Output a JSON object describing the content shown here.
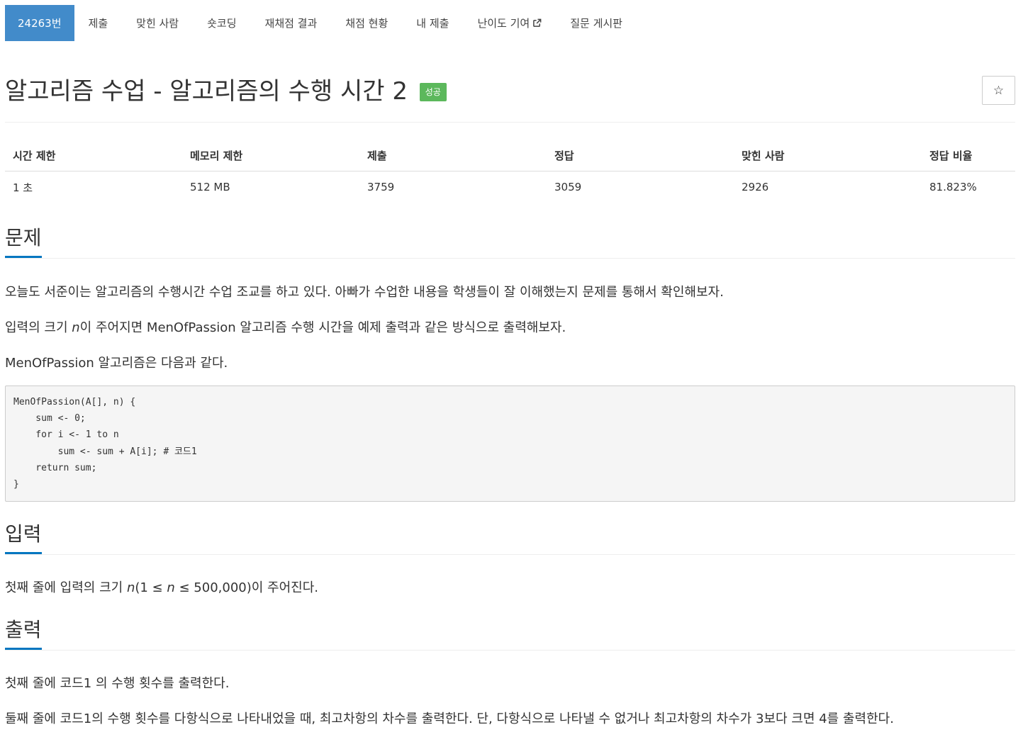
{
  "nav": {
    "items": [
      {
        "label": "24263번"
      },
      {
        "label": "제출"
      },
      {
        "label": "맞힌 사람"
      },
      {
        "label": "숏코딩"
      },
      {
        "label": "재채점 결과"
      },
      {
        "label": "채점 현황"
      },
      {
        "label": "내 제출"
      },
      {
        "label": "난이도 기여",
        "icon": "external-link-icon"
      },
      {
        "label": "질문 게시판"
      }
    ]
  },
  "problem": {
    "title": "알고리즘 수업 - 알고리즘의 수행 시간 2",
    "status_badge": "성공",
    "status_color": "#5cb85c",
    "star_icon": "☆"
  },
  "info_table": {
    "headers": [
      "시간 제한",
      "메모리 제한",
      "제출",
      "정답",
      "맞힌 사람",
      "정답 비율"
    ],
    "values": [
      "1 초",
      "512 MB",
      "3759",
      "3059",
      "2926",
      "81.823%"
    ]
  },
  "description": {
    "heading": "문제",
    "p1": "오늘도 서준이는 알고리즘의 수행시간 수업 조교를 하고 있다. 아빠가 수업한 내용을 학생들이 잘 이해했는지 문제를 통해서 확인해보자.",
    "p2_pre": "입력의 크기 ",
    "p2_var": "n",
    "p2_post": "이 주어지면 MenOfPassion 알고리즘 수행 시간을 예제 출력과 같은 방식으로 출력해보자.",
    "p3": "MenOfPassion 알고리즘은 다음과 같다.",
    "code": "MenOfPassion(A[], n) {\n    sum <- 0;\n    for i <- 1 to n\n        sum <- sum + A[i]; # 코드1\n    return sum;\n}"
  },
  "input": {
    "heading": "입력",
    "p_pre": "첫째 줄에 입력의 크기 ",
    "p_var1": "n",
    "p_mid": "(1 ≤ ",
    "p_var2": "n",
    "p_post": " ≤ 500,000)이 주어진다."
  },
  "output": {
    "heading": "출력",
    "p1": "첫째 줄에 코드1 의 수행 횟수를 출력한다.",
    "p2": "둘째 줄에 코드1의 수행 횟수를 다항식으로 나타내었을 때, 최고차항의 차수를 출력한다. 단, 다항식으로 나타낼 수 없거나 최고차항의 차수가 3보다 크면 4를 출력한다."
  },
  "colors": {
    "accent": "#428bca",
    "section_underline": "#0076c0",
    "success": "#5cb85c"
  }
}
